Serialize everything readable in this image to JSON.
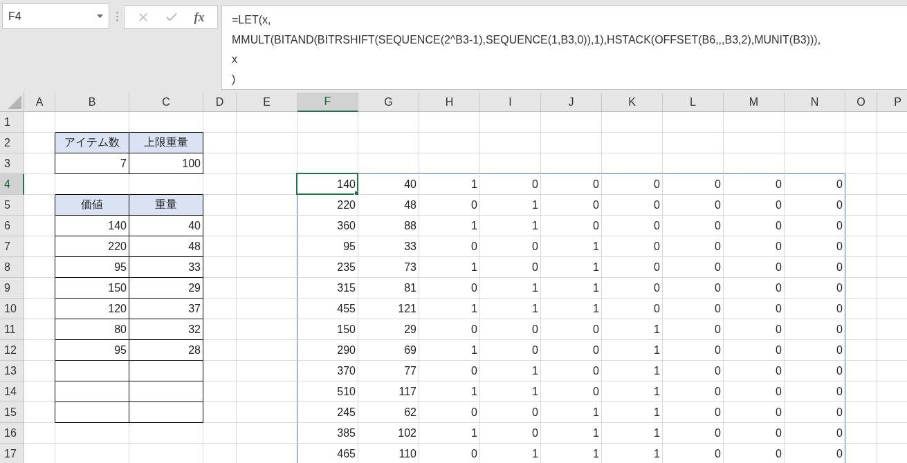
{
  "name_box": {
    "value": "F4"
  },
  "formula_bar": {
    "function_button": "fx",
    "lines": [
      "=LET(x,",
      "MMULT(BITAND(BITRSHIFT(SEQUENCE(2^B3-1),SEQUENCE(1,B3,0)),1),HSTACK(OFFSET(B6,,,B3,2),MUNIT(B3))),",
      "x",
      ")"
    ]
  },
  "columns": [
    {
      "label": "A",
      "selected": false
    },
    {
      "label": "B",
      "selected": false
    },
    {
      "label": "C",
      "selected": false
    },
    {
      "label": "D",
      "selected": false
    },
    {
      "label": "E",
      "selected": false
    },
    {
      "label": "F",
      "selected": true
    },
    {
      "label": "G",
      "selected": false
    },
    {
      "label": "H",
      "selected": false
    },
    {
      "label": "I",
      "selected": false
    },
    {
      "label": "J",
      "selected": false
    },
    {
      "label": "K",
      "selected": false
    },
    {
      "label": "L",
      "selected": false
    },
    {
      "label": "M",
      "selected": false
    },
    {
      "label": "N",
      "selected": false
    },
    {
      "label": "O",
      "selected": false
    },
    {
      "label": "P",
      "selected": false
    }
  ],
  "rows": [
    {
      "label": "1",
      "selected": false,
      "cells": []
    },
    {
      "label": "2",
      "selected": false,
      "cells": [
        null,
        {
          "kind": "header",
          "text": "アイテム数"
        },
        {
          "kind": "header",
          "text": "上限重量"
        }
      ]
    },
    {
      "label": "3",
      "selected": false,
      "cells": [
        null,
        {
          "kind": "boxed",
          "text": "7"
        },
        {
          "kind": "boxed",
          "text": "100"
        }
      ]
    },
    {
      "label": "4",
      "selected": true,
      "cells": [
        null,
        null,
        null,
        null,
        null,
        {
          "kind": "spill",
          "text": "140"
        },
        {
          "kind": "spill",
          "text": "40"
        },
        {
          "kind": "spill",
          "text": "1"
        },
        {
          "kind": "spill",
          "text": "0"
        },
        {
          "kind": "spill",
          "text": "0"
        },
        {
          "kind": "spill",
          "text": "0"
        },
        {
          "kind": "spill",
          "text": "0"
        },
        {
          "kind": "spill",
          "text": "0"
        },
        {
          "kind": "spill",
          "text": "0"
        }
      ]
    },
    {
      "label": "5",
      "selected": false,
      "cells": [
        null,
        {
          "kind": "header",
          "text": "価値"
        },
        {
          "kind": "header",
          "text": "重量"
        },
        null,
        null,
        {
          "kind": "spill",
          "text": "220"
        },
        {
          "kind": "spill",
          "text": "48"
        },
        {
          "kind": "spill",
          "text": "0"
        },
        {
          "kind": "spill",
          "text": "1"
        },
        {
          "kind": "spill",
          "text": "0"
        },
        {
          "kind": "spill",
          "text": "0"
        },
        {
          "kind": "spill",
          "text": "0"
        },
        {
          "kind": "spill",
          "text": "0"
        },
        {
          "kind": "spill",
          "text": "0"
        }
      ]
    },
    {
      "label": "6",
      "selected": false,
      "cells": [
        null,
        {
          "kind": "boxed",
          "text": "140"
        },
        {
          "kind": "boxed",
          "text": "40"
        },
        null,
        null,
        {
          "kind": "spill",
          "text": "360"
        },
        {
          "kind": "spill",
          "text": "88"
        },
        {
          "kind": "spill",
          "text": "1"
        },
        {
          "kind": "spill",
          "text": "1"
        },
        {
          "kind": "spill",
          "text": "0"
        },
        {
          "kind": "spill",
          "text": "0"
        },
        {
          "kind": "spill",
          "text": "0"
        },
        {
          "kind": "spill",
          "text": "0"
        },
        {
          "kind": "spill",
          "text": "0"
        }
      ]
    },
    {
      "label": "7",
      "selected": false,
      "cells": [
        null,
        {
          "kind": "boxed",
          "text": "220"
        },
        {
          "kind": "boxed",
          "text": "48"
        },
        null,
        null,
        {
          "kind": "spill",
          "text": "95"
        },
        {
          "kind": "spill",
          "text": "33"
        },
        {
          "kind": "spill",
          "text": "0"
        },
        {
          "kind": "spill",
          "text": "0"
        },
        {
          "kind": "spill",
          "text": "1"
        },
        {
          "kind": "spill",
          "text": "0"
        },
        {
          "kind": "spill",
          "text": "0"
        },
        {
          "kind": "spill",
          "text": "0"
        },
        {
          "kind": "spill",
          "text": "0"
        }
      ]
    },
    {
      "label": "8",
      "selected": false,
      "cells": [
        null,
        {
          "kind": "boxed",
          "text": "95"
        },
        {
          "kind": "boxed",
          "text": "33"
        },
        null,
        null,
        {
          "kind": "spill",
          "text": "235"
        },
        {
          "kind": "spill",
          "text": "73"
        },
        {
          "kind": "spill",
          "text": "1"
        },
        {
          "kind": "spill",
          "text": "0"
        },
        {
          "kind": "spill",
          "text": "1"
        },
        {
          "kind": "spill",
          "text": "0"
        },
        {
          "kind": "spill",
          "text": "0"
        },
        {
          "kind": "spill",
          "text": "0"
        },
        {
          "kind": "spill",
          "text": "0"
        }
      ]
    },
    {
      "label": "9",
      "selected": false,
      "cells": [
        null,
        {
          "kind": "boxed",
          "text": "150"
        },
        {
          "kind": "boxed",
          "text": "29"
        },
        null,
        null,
        {
          "kind": "spill",
          "text": "315"
        },
        {
          "kind": "spill",
          "text": "81"
        },
        {
          "kind": "spill",
          "text": "0"
        },
        {
          "kind": "spill",
          "text": "1"
        },
        {
          "kind": "spill",
          "text": "1"
        },
        {
          "kind": "spill",
          "text": "0"
        },
        {
          "kind": "spill",
          "text": "0"
        },
        {
          "kind": "spill",
          "text": "0"
        },
        {
          "kind": "spill",
          "text": "0"
        }
      ]
    },
    {
      "label": "10",
      "selected": false,
      "cells": [
        null,
        {
          "kind": "boxed",
          "text": "120"
        },
        {
          "kind": "boxed",
          "text": "37"
        },
        null,
        null,
        {
          "kind": "spill",
          "text": "455"
        },
        {
          "kind": "spill",
          "text": "121"
        },
        {
          "kind": "spill",
          "text": "1"
        },
        {
          "kind": "spill",
          "text": "1"
        },
        {
          "kind": "spill",
          "text": "1"
        },
        {
          "kind": "spill",
          "text": "0"
        },
        {
          "kind": "spill",
          "text": "0"
        },
        {
          "kind": "spill",
          "text": "0"
        },
        {
          "kind": "spill",
          "text": "0"
        }
      ]
    },
    {
      "label": "11",
      "selected": false,
      "cells": [
        null,
        {
          "kind": "boxed",
          "text": "80"
        },
        {
          "kind": "boxed",
          "text": "32"
        },
        null,
        null,
        {
          "kind": "spill",
          "text": "150"
        },
        {
          "kind": "spill",
          "text": "29"
        },
        {
          "kind": "spill",
          "text": "0"
        },
        {
          "kind": "spill",
          "text": "0"
        },
        {
          "kind": "spill",
          "text": "0"
        },
        {
          "kind": "spill",
          "text": "1"
        },
        {
          "kind": "spill",
          "text": "0"
        },
        {
          "kind": "spill",
          "text": "0"
        },
        {
          "kind": "spill",
          "text": "0"
        }
      ]
    },
    {
      "label": "12",
      "selected": false,
      "cells": [
        null,
        {
          "kind": "boxed",
          "text": "95"
        },
        {
          "kind": "boxed",
          "text": "28"
        },
        null,
        null,
        {
          "kind": "spill",
          "text": "290"
        },
        {
          "kind": "spill",
          "text": "69"
        },
        {
          "kind": "spill",
          "text": "1"
        },
        {
          "kind": "spill",
          "text": "0"
        },
        {
          "kind": "spill",
          "text": "0"
        },
        {
          "kind": "spill",
          "text": "1"
        },
        {
          "kind": "spill",
          "text": "0"
        },
        {
          "kind": "spill",
          "text": "0"
        },
        {
          "kind": "spill",
          "text": "0"
        }
      ]
    },
    {
      "label": "13",
      "selected": false,
      "cells": [
        null,
        {
          "kind": "blank"
        },
        {
          "kind": "blank"
        },
        null,
        null,
        {
          "kind": "spill",
          "text": "370"
        },
        {
          "kind": "spill",
          "text": "77"
        },
        {
          "kind": "spill",
          "text": "0"
        },
        {
          "kind": "spill",
          "text": "1"
        },
        {
          "kind": "spill",
          "text": "0"
        },
        {
          "kind": "spill",
          "text": "1"
        },
        {
          "kind": "spill",
          "text": "0"
        },
        {
          "kind": "spill",
          "text": "0"
        },
        {
          "kind": "spill",
          "text": "0"
        }
      ]
    },
    {
      "label": "14",
      "selected": false,
      "cells": [
        null,
        {
          "kind": "blank"
        },
        {
          "kind": "blank"
        },
        null,
        null,
        {
          "kind": "spill",
          "text": "510"
        },
        {
          "kind": "spill",
          "text": "117"
        },
        {
          "kind": "spill",
          "text": "1"
        },
        {
          "kind": "spill",
          "text": "1"
        },
        {
          "kind": "spill",
          "text": "0"
        },
        {
          "kind": "spill",
          "text": "1"
        },
        {
          "kind": "spill",
          "text": "0"
        },
        {
          "kind": "spill",
          "text": "0"
        },
        {
          "kind": "spill",
          "text": "0"
        }
      ]
    },
    {
      "label": "15",
      "selected": false,
      "cells": [
        null,
        {
          "kind": "blank"
        },
        {
          "kind": "blank"
        },
        null,
        null,
        {
          "kind": "spill",
          "text": "245"
        },
        {
          "kind": "spill",
          "text": "62"
        },
        {
          "kind": "spill",
          "text": "0"
        },
        {
          "kind": "spill",
          "text": "0"
        },
        {
          "kind": "spill",
          "text": "1"
        },
        {
          "kind": "spill",
          "text": "1"
        },
        {
          "kind": "spill",
          "text": "0"
        },
        {
          "kind": "spill",
          "text": "0"
        },
        {
          "kind": "spill",
          "text": "0"
        }
      ]
    },
    {
      "label": "16",
      "selected": false,
      "cells": [
        null,
        null,
        null,
        null,
        null,
        {
          "kind": "spill",
          "text": "385"
        },
        {
          "kind": "spill",
          "text": "102"
        },
        {
          "kind": "spill",
          "text": "1"
        },
        {
          "kind": "spill",
          "text": "0"
        },
        {
          "kind": "spill",
          "text": "1"
        },
        {
          "kind": "spill",
          "text": "1"
        },
        {
          "kind": "spill",
          "text": "0"
        },
        {
          "kind": "spill",
          "text": "0"
        },
        {
          "kind": "spill",
          "text": "0"
        }
      ]
    },
    {
      "label": "17",
      "selected": false,
      "cells": [
        null,
        null,
        null,
        null,
        null,
        {
          "kind": "spill",
          "text": "465"
        },
        {
          "kind": "spill",
          "text": "110"
        },
        {
          "kind": "spill",
          "text": "0"
        },
        {
          "kind": "spill",
          "text": "1"
        },
        {
          "kind": "spill",
          "text": "1"
        },
        {
          "kind": "spill",
          "text": "1"
        },
        {
          "kind": "spill",
          "text": "0"
        },
        {
          "kind": "spill",
          "text": "0"
        },
        {
          "kind": "spill",
          "text": "0"
        }
      ]
    }
  ]
}
